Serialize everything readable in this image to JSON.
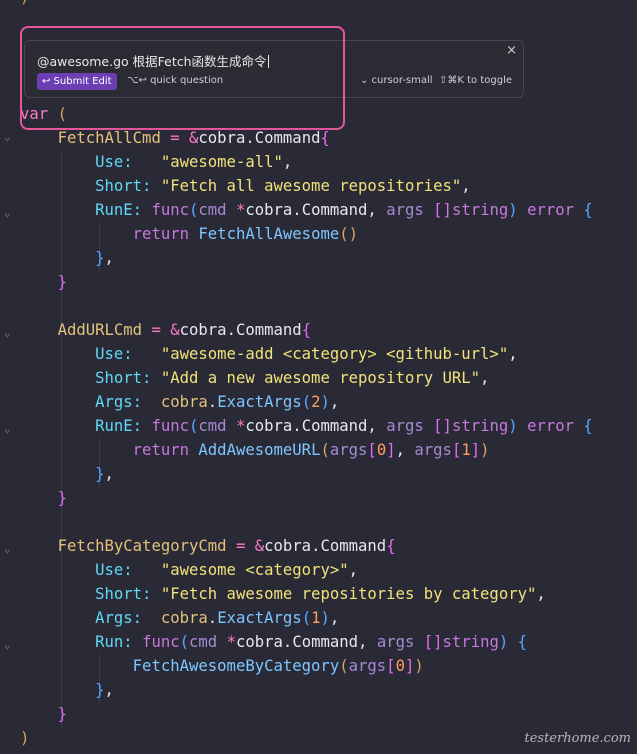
{
  "popup": {
    "prompt_text": "@awesome.go 根据Fetch函数生成命令",
    "submit_label": "↩ Submit Edit",
    "quick_question": "⌥↩ quick question",
    "model": "⌄ cursor-small",
    "toggle_hint": "⇧⌘K to toggle",
    "close": "×"
  },
  "code": {
    "top_brace": ")",
    "l_var": "var",
    "l_var_paren": "(",
    "c1_name": "FetchAllCmd",
    "c1_pkg": "cobra",
    "c1_type": "Command",
    "c1_use_key": "Use:",
    "c1_use_val": "\"awesome-all\"",
    "c1_short_key": "Short:",
    "c1_short_val": "\"Fetch all awesome repositories\"",
    "c1_rune_key": "RunE:",
    "c1_ret_call": "FetchAllAwesome",
    "c2_name": "AddURLCmd",
    "c2_use_val": "\"awesome-add <category> <github-url>\"",
    "c2_short_val": "\"Add a new awesome repository URL\"",
    "c2_args_key": "Args:",
    "c2_exact": "ExactArgs",
    "c2_exact_n": "2",
    "c2_ret_call": "AddAwesomeURL",
    "c3_name": "FetchByCategoryCmd",
    "c3_use_val": "\"awesome <category>\"",
    "c3_short_val": "\"Fetch awesome repositories by category\"",
    "c3_exact_n": "1",
    "c3_run_key": "Run:",
    "c3_call": "FetchAwesomeByCategory",
    "kw_func": "func",
    "kw_return": "return",
    "kw_error": "error",
    "kw_string": "string",
    "p_cmd": "cmd",
    "p_args": "args",
    "idx0": "0",
    "idx1": "1",
    "close_paren": ")"
  },
  "watermark": "testerhome.com"
}
